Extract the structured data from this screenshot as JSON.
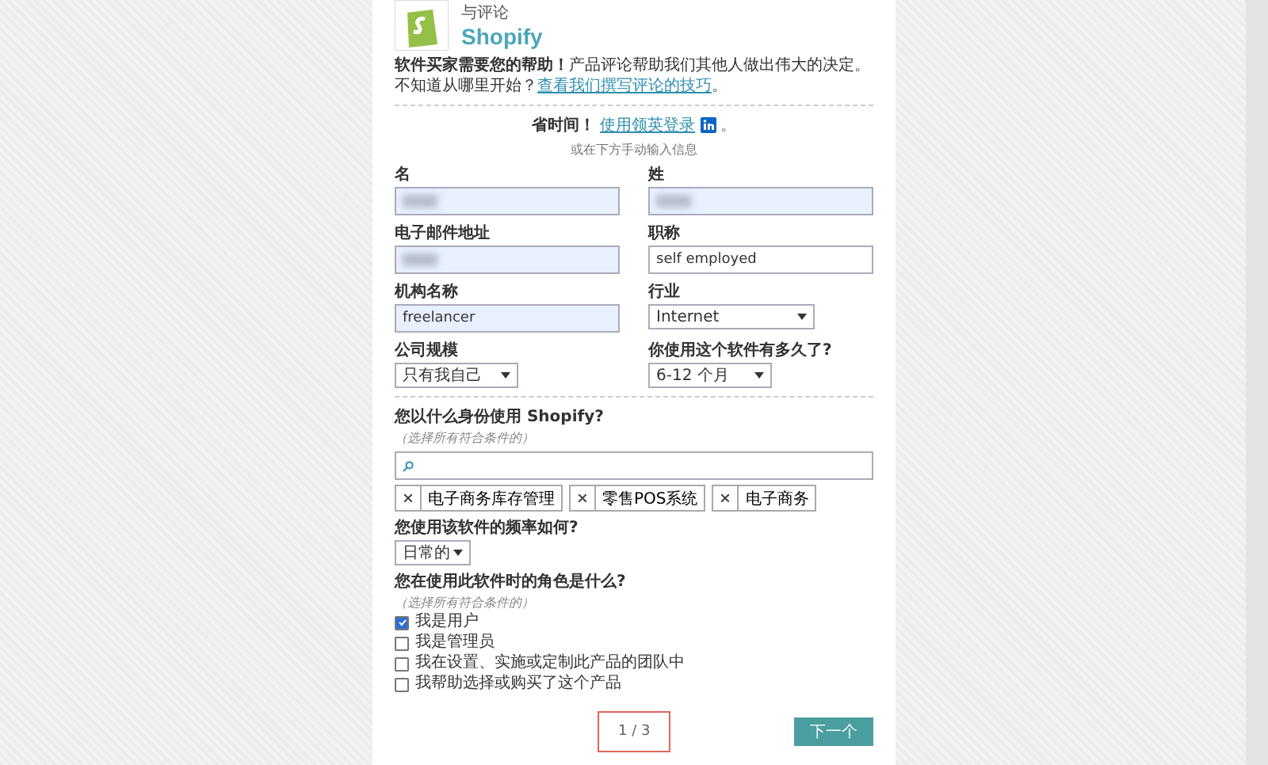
{
  "header": {
    "title": "与评论",
    "brand": "Shopify"
  },
  "intro": {
    "text": "**软件买家需要您的帮助！**产品评论帮助我们其他人做出伟大的决定。不知道从哪里开始？",
    "link": "查看我们撰写评论的技巧",
    "end": "。"
  },
  "linkedin": {
    "prefix": "省时间！",
    "link": "使用领英登录",
    "end": "。",
    "note": "或在下方手动输入信息"
  },
  "fields": [
    {
      "label": "名",
      "kind": "text",
      "redacted": true,
      "filled": true
    },
    {
      "label": "姓",
      "kind": "text",
      "redacted": true,
      "filled": true
    },
    {
      "label": "电子邮件地址",
      "kind": "text",
      "redacted": true,
      "filled": true
    },
    {
      "label": "职称",
      "kind": "text",
      "value": "self employed",
      "redacted": false,
      "filled": false
    },
    {
      "label": "机构名称",
      "kind": "text",
      "value": "freelancer",
      "redacted": false,
      "filled": true
    },
    {
      "label": "行业",
      "kind": "select",
      "value": "Internet"
    },
    {
      "label": "公司规模",
      "kind": "select",
      "value": "只有我自己"
    },
    {
      "label": "你使用这个软件有多久了?",
      "kind": "select",
      "value": "6-12 个月"
    }
  ],
  "usage": {
    "question": "您以什么身份使用 Shopify?",
    "hint": "（选择所有符合条件的）",
    "tags": [
      "电子商务库存管理",
      "零售POS系统",
      "电子商务"
    ]
  },
  "frequency": {
    "question": "您使用该软件的频率如何?",
    "value": "日常的"
  },
  "role": {
    "question": "您在使用此软件时的角色是什么?",
    "hint": "（选择所有符合条件的）",
    "options": [
      {
        "label": "我是用户",
        "checked": true
      },
      {
        "label": "我是管理员",
        "checked": false
      },
      {
        "label": "我在设置、实施或定制此产品的团队中",
        "checked": false
      },
      {
        "label": "我帮助选择或购买了这个产品",
        "checked": false
      }
    ]
  },
  "footer": {
    "page": "1 / 3",
    "next": "下一个"
  }
}
